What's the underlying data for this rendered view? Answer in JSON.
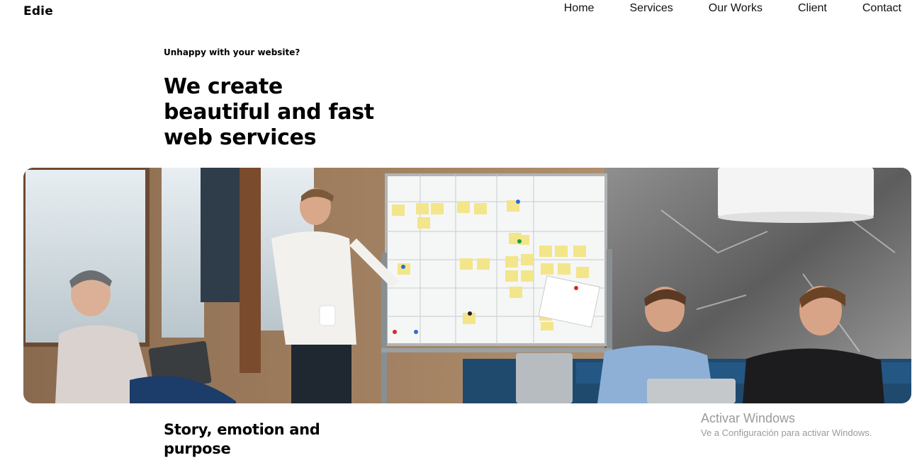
{
  "brand": {
    "logo": "Edie"
  },
  "nav": {
    "items": [
      "Home",
      "Services",
      "Our Works",
      "Client",
      "Contact"
    ]
  },
  "hero": {
    "eyebrow": "Unhappy with your website?",
    "headline_lines": [
      "We create",
      "beautiful and fast",
      "web services"
    ],
    "image": "team-meeting-whiteboard-photo"
  },
  "section": {
    "subhead_lines": [
      "Story, emotion and",
      "purpose"
    ]
  },
  "os_watermark": {
    "title": "Activar Windows",
    "subtitle": "Ve a Configuración para activar Windows."
  },
  "colors": {
    "text": "#000000",
    "watermark": "#9a9a9a",
    "background": "#ffffff"
  }
}
